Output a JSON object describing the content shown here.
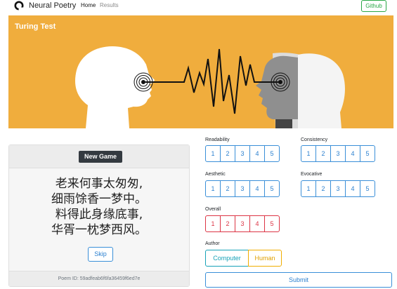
{
  "navbar": {
    "brand": "Neural Poetry",
    "links": [
      "Home",
      "Results"
    ],
    "github": "Github"
  },
  "hero": {
    "title": "Turing Test",
    "background": "#f0ad3d"
  },
  "game": {
    "new_game": "New Game",
    "poem_lines": [
      "老来何事太匆匆,",
      "细雨馀香一梦中。",
      "料得此身缘底事,",
      "华胥一枕梦西风。"
    ],
    "skip": "Skip",
    "poem_id": "Poem ID: 59adfeab6f6fa36459f6ed7e"
  },
  "ratings": [
    {
      "label": "Readability",
      "options": [
        "1",
        "2",
        "3",
        "4",
        "5"
      ],
      "color": "#3a8fd8"
    },
    {
      "label": "Consistency",
      "options": [
        "1",
        "2",
        "3",
        "4",
        "5"
      ],
      "color": "#3a8fd8"
    },
    {
      "label": "Aesthetic",
      "options": [
        "1",
        "2",
        "3",
        "4",
        "5"
      ],
      "color": "#3a8fd8"
    },
    {
      "label": "Evocative",
      "options": [
        "1",
        "2",
        "3",
        "4",
        "5"
      ],
      "color": "#3a8fd8"
    },
    {
      "label": "Overall",
      "options": [
        "1",
        "2",
        "3",
        "4",
        "5"
      ],
      "color": "#dc3545"
    }
  ],
  "author": {
    "label": "Author",
    "options": [
      "Computer",
      "Human"
    ],
    "colors": {
      "computer": "#17a2b8",
      "human": "#f0ad00"
    }
  },
  "submit": "Submit"
}
